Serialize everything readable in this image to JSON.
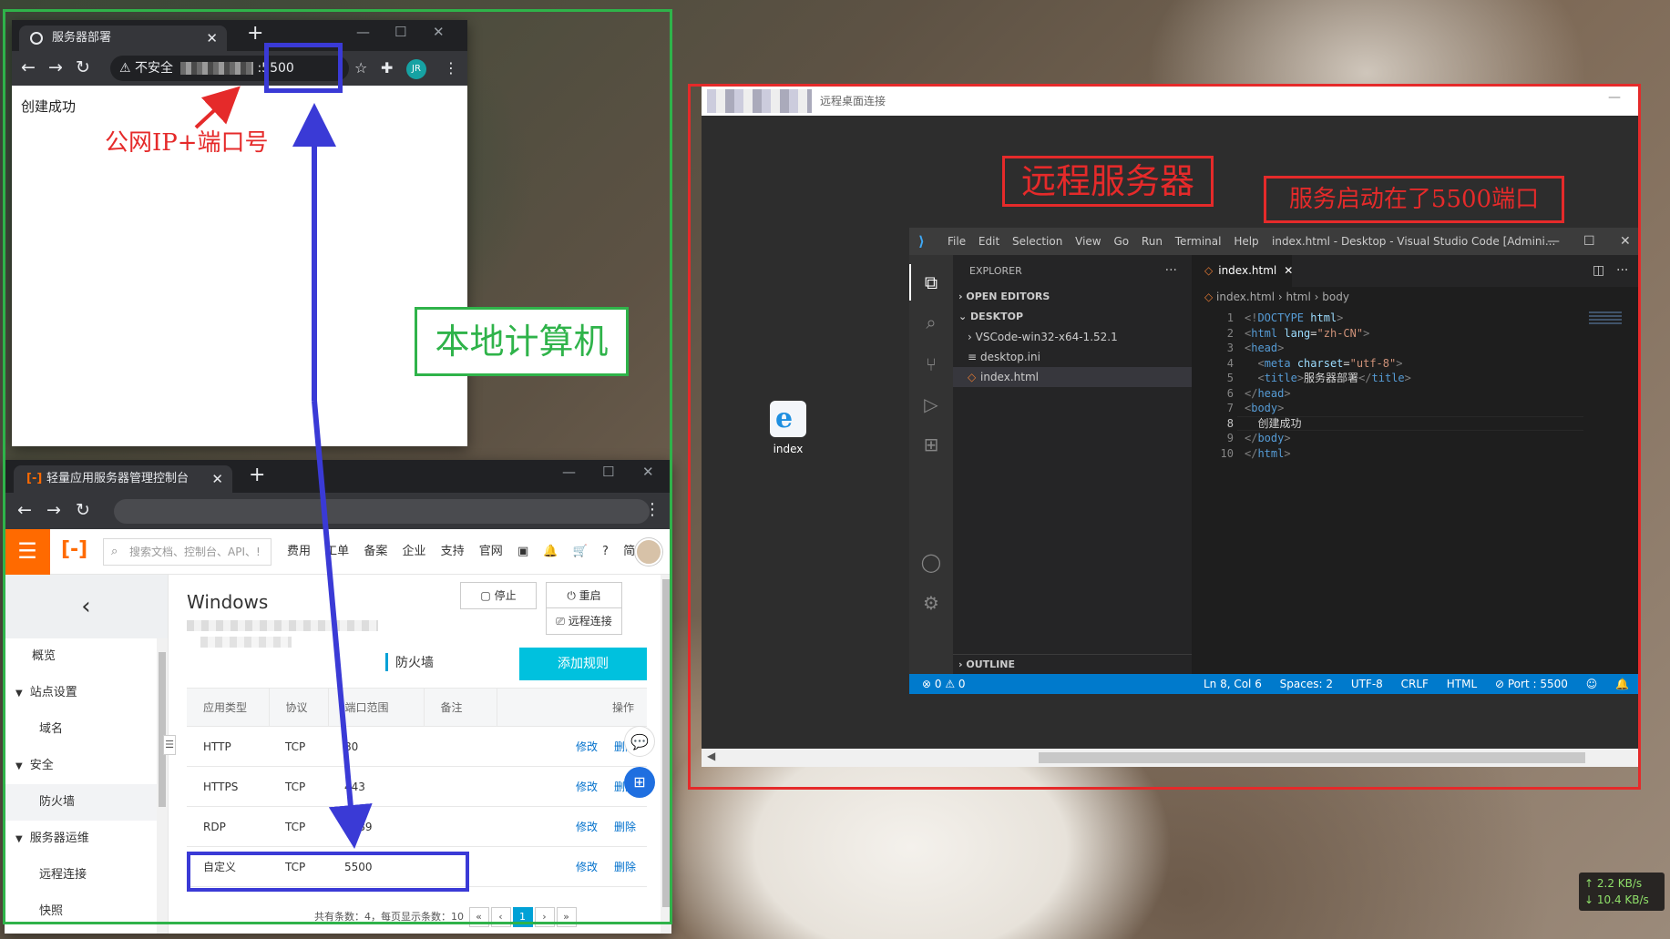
{
  "browser_local": {
    "tab_title": "服务器部署",
    "address_warning": "不安全",
    "address_port": ":5500",
    "avatar_initials": "JR",
    "page_text": "创建成功"
  },
  "browser_console": {
    "tab_title": "轻量应用服务器管理控制台",
    "header": {
      "search_placeholder": "搜索文档、控制台、API、!",
      "nav_items": [
        "费用",
        "工单",
        "备案",
        "企业",
        "支持",
        "官网",
        "▣",
        "🔔",
        "🛒",
        "?",
        "简体"
      ]
    },
    "sidebar": {
      "items": [
        {
          "label": "概览",
          "type": "item"
        },
        {
          "label": "站点设置",
          "type": "group"
        },
        {
          "label": "域名",
          "type": "sub"
        },
        {
          "label": "安全",
          "type": "group"
        },
        {
          "label": "防火墙",
          "type": "sub",
          "active": true
        },
        {
          "label": "服务器运维",
          "type": "group"
        },
        {
          "label": "远程连接",
          "type": "sub"
        },
        {
          "label": "快照",
          "type": "sub"
        }
      ]
    },
    "main": {
      "title": "Windows",
      "stop_button": "停止",
      "restart_button": "重启",
      "remote_button": "远程连接",
      "section_label": "防火墙",
      "add_rule_button": "添加规则",
      "table": {
        "headers": [
          "应用类型",
          "协议",
          "端口范围",
          "备注",
          "操作"
        ],
        "rows": [
          {
            "app": "HTTP",
            "proto": "TCP",
            "port": "80",
            "note": "",
            "edit": "修改",
            "del": "删除"
          },
          {
            "app": "HTTPS",
            "proto": "TCP",
            "port": "443",
            "note": "",
            "edit": "修改",
            "del": "删除"
          },
          {
            "app": "RDP",
            "proto": "TCP",
            "port": "3389",
            "note": "",
            "edit": "修改",
            "del": "删除"
          },
          {
            "app": "自定义",
            "proto": "TCP",
            "port": "5500",
            "note": "",
            "edit": "修改",
            "del": "删除"
          }
        ]
      },
      "pager": {
        "summary": "共有条数：4，每页显示条数：10",
        "current_page": "1"
      }
    }
  },
  "remote_desktop": {
    "window_title": "远程桌面连接",
    "desktop_icon_label": "index",
    "vscode": {
      "menu": [
        "File",
        "Edit",
        "Selection",
        "View",
        "Go",
        "Run",
        "Terminal",
        "Help"
      ],
      "window_title": "index.html - Desktop - Visual Studio Code [Admini...",
      "explorer_title": "EXPLORER",
      "open_editors": "OPEN EDITORS",
      "desktop_section": "DESKTOP",
      "files": [
        {
          "name": "VSCode-win32-x64-1.52.1",
          "kind": "folder"
        },
        {
          "name": "desktop.ini",
          "kind": "file"
        },
        {
          "name": "index.html",
          "kind": "html",
          "selected": true
        }
      ],
      "outline": "OUTLINE",
      "tab": "index.html",
      "breadcrumb": [
        "index.html",
        "html",
        "body"
      ],
      "code": [
        {
          "n": "1",
          "parts": [
            [
              "tg",
              "<!"
            ],
            [
              "tn",
              "DOCTYPE"
            ],
            [
              "tx",
              " "
            ],
            [
              "at",
              "html"
            ],
            [
              "tg",
              ">"
            ]
          ]
        },
        {
          "n": "2",
          "parts": [
            [
              "tg",
              "<"
            ],
            [
              "tn",
              "html"
            ],
            [
              "tx",
              " "
            ],
            [
              "at",
              "lang"
            ],
            [
              "tx",
              "="
            ],
            [
              "sv",
              "\"zh-CN\""
            ],
            [
              "tg",
              ">"
            ]
          ]
        },
        {
          "n": "3",
          "parts": [
            [
              "tg",
              "<"
            ],
            [
              "tn",
              "head"
            ],
            [
              "tg",
              ">"
            ]
          ]
        },
        {
          "n": "4",
          "parts": [
            [
              "tx",
              "  "
            ],
            [
              "tg",
              "<"
            ],
            [
              "tn",
              "meta"
            ],
            [
              "tx",
              " "
            ],
            [
              "at",
              "charset"
            ],
            [
              "tx",
              "="
            ],
            [
              "sv",
              "\"utf-8\""
            ],
            [
              "tg",
              ">"
            ]
          ]
        },
        {
          "n": "5",
          "parts": [
            [
              "tx",
              "  "
            ],
            [
              "tg",
              "<"
            ],
            [
              "tn",
              "title"
            ],
            [
              "tg",
              ">"
            ],
            [
              "tx",
              "服务器部署"
            ],
            [
              "tg",
              "</"
            ],
            [
              "tn",
              "title"
            ],
            [
              "tg",
              ">"
            ]
          ]
        },
        {
          "n": "6",
          "parts": [
            [
              "tg",
              "</"
            ],
            [
              "tn",
              "head"
            ],
            [
              "tg",
              ">"
            ]
          ]
        },
        {
          "n": "7",
          "parts": [
            [
              "tg",
              "<"
            ],
            [
              "tn",
              "body"
            ],
            [
              "tg",
              ">"
            ]
          ]
        },
        {
          "n": "8",
          "parts": [
            [
              "tx",
              "  创建成功"
            ]
          ],
          "current": true
        },
        {
          "n": "9",
          "parts": [
            [
              "tg",
              "</"
            ],
            [
              "tn",
              "body"
            ],
            [
              "tg",
              ">"
            ]
          ]
        },
        {
          "n": "10",
          "parts": [
            [
              "tg",
              "</"
            ],
            [
              "tn",
              "html"
            ],
            [
              "tg",
              ">"
            ]
          ]
        }
      ],
      "status": {
        "problems": "⊗ 0 ⚠ 0",
        "items": [
          "Ln 8, Col 6",
          "Spaces: 2",
          "UTF-8",
          "CRLF",
          "HTML",
          "⊘ Port : 5500"
        ]
      }
    }
  },
  "annotations": {
    "public_ip_port": "公网IP+端口号",
    "local_computer": "本地计算机",
    "remote_server": "远程服务器",
    "service_started": "服务启动在了5500端口"
  },
  "network_speed": {
    "up": "↑ 2.2 KB/s",
    "down": "↓ 10.4 KB/s"
  },
  "colors": {
    "annotation_red": "#e52a2a",
    "annotation_green": "#2fb34a",
    "annotation_blue": "#3a3ad6",
    "vscode_status": "#007acc",
    "aliyun_orange": "#ff6a00",
    "aliyun_cyan": "#00c1de"
  }
}
